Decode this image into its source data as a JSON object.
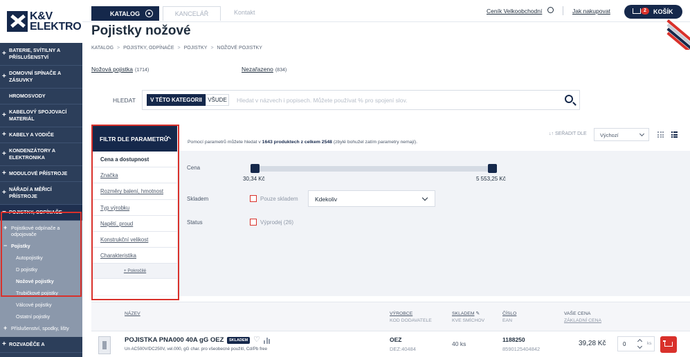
{
  "brand": {
    "line1": "K&V",
    "line2": "ELEKTRO"
  },
  "topbar": {
    "tab_katalog": "KATALOG",
    "tab_kancelar": "KANCELÁŘ",
    "tab_kontakt": "Kontakt",
    "link_cenik": "Ceník Velkoobchodní",
    "link_jak": "Jak nakupovat",
    "cart_count": "2",
    "cart_label": "KOŠÍK"
  },
  "sidebar": {
    "items": [
      {
        "label": "BATERIE, SVÍTILNY A PŘÍSLUŠENSTVÍ",
        "prefix": "+"
      },
      {
        "label": "DOMOVNÍ SPÍNAČE A ZÁSUVKY",
        "prefix": "+"
      },
      {
        "label": "HROMOSVODY",
        "prefix": ""
      },
      {
        "label": "KABELOVÝ SPOJOVACÍ MATERIÁL",
        "prefix": "+"
      },
      {
        "label": "KABELY A VODIČE",
        "prefix": "+"
      },
      {
        "label": "KONDENZÁTORY A ELEKTRONIKA",
        "prefix": "+"
      },
      {
        "label": "MODULOVÉ PŘÍSTROJE",
        "prefix": "+"
      },
      {
        "label": "NÁŘADÍ A MĚŘICÍ PŘÍSTROJE",
        "prefix": "+"
      },
      {
        "label": "POJISTKY, ODPÍNAČE",
        "prefix": "−"
      }
    ],
    "sub": [
      {
        "label": "Pojistkové odpínače a odpojovače",
        "prefix": "+"
      },
      {
        "label": "Pojistky",
        "prefix": "−"
      },
      {
        "label": "Autopojistky"
      },
      {
        "label": "D pojistky"
      },
      {
        "label": "Nožové pojistky"
      },
      {
        "label": "Trubičkové pojistky"
      },
      {
        "label": "Válcové pojistky"
      },
      {
        "label": "Ostatní pojistky"
      },
      {
        "label": "Příslušenství, spodky, lišty",
        "prefix": "+"
      }
    ],
    "last": {
      "label": "ROZVADĚČE A",
      "prefix": "+"
    }
  },
  "page": {
    "title": "Pojistky nožové",
    "breadcrumb": [
      "KATALOG",
      "POJISTKY, ODPÍNAČE",
      "POJISTKY",
      "NOŽOVÉ POJISTKY"
    ],
    "breadcrumb_sep": ">"
  },
  "categories": [
    {
      "name": "Nožová pojistka",
      "count": "(1714)"
    },
    {
      "name": "Nezařazeno",
      "count": "(834)"
    }
  ],
  "search": {
    "label": "HLEDAT",
    "seg_category": "V TÉTO KATEGORII",
    "seg_all": "VŠUDE",
    "placeholder": "Hledat v názvech i popisech. Můžete používat % pro spojení slov."
  },
  "filter": {
    "button": "FILTR DLE PARAMETRŮ",
    "items": [
      "Cena a dostupnost",
      "Značka",
      "Rozměry balení, hmotnost",
      "Typ výrobku",
      "Napětí, proud",
      "Konstrukční velikost",
      "Charakteristika"
    ],
    "advanced": "+ Pokročilé",
    "info_pre": "Pomocí parametrů můžete hledat v ",
    "info_bold": "1643 produktech z celkem 2548",
    "info_post": " (zbylé bohužel zatím parametry nemají).",
    "price_label": "Cena",
    "price_min": "30,34 Kč",
    "price_max": "5 553,25 Kč",
    "stock_label": "Skladem",
    "stock_only": "Pouze skladem",
    "stock_select": "Kdekoliv",
    "status_label": "Status",
    "status_option": "Výprodej (26)"
  },
  "sort": {
    "label": "↓↑ SEŘADIT DLE",
    "value": "Výchozí"
  },
  "table": {
    "headers": {
      "name": "NÁZEV",
      "maker": "VÝROBCE",
      "maker_sub": "KOD DODAVATELE",
      "stock": "SKLADEM",
      "stock_sub": "KVE SMÍCHOV",
      "number": "ČÍSLO",
      "number_sub": "EAN",
      "price": "VAŠE CENA",
      "price_sub": "ZÁKLADNÍ CENA"
    },
    "rows": [
      {
        "name": "POJISTKA PNA000 40A gG OEZ",
        "badge": "SKLADEM",
        "desc": "Un AC500V/DC250V, vel.000, gG char. pro všeobecné použití, Cd/Pb free",
        "maker": "OEZ",
        "maker_code": "DEZ:40484",
        "stock": "40 ks",
        "number": "1188250",
        "ean": "8590125404842",
        "price": "39,28 Kč",
        "qty": "0",
        "unit": "ks"
      }
    ]
  },
  "colors": {
    "navy": "#15284b",
    "red": "#d9312b",
    "sidebar": "#2c3e5a"
  }
}
